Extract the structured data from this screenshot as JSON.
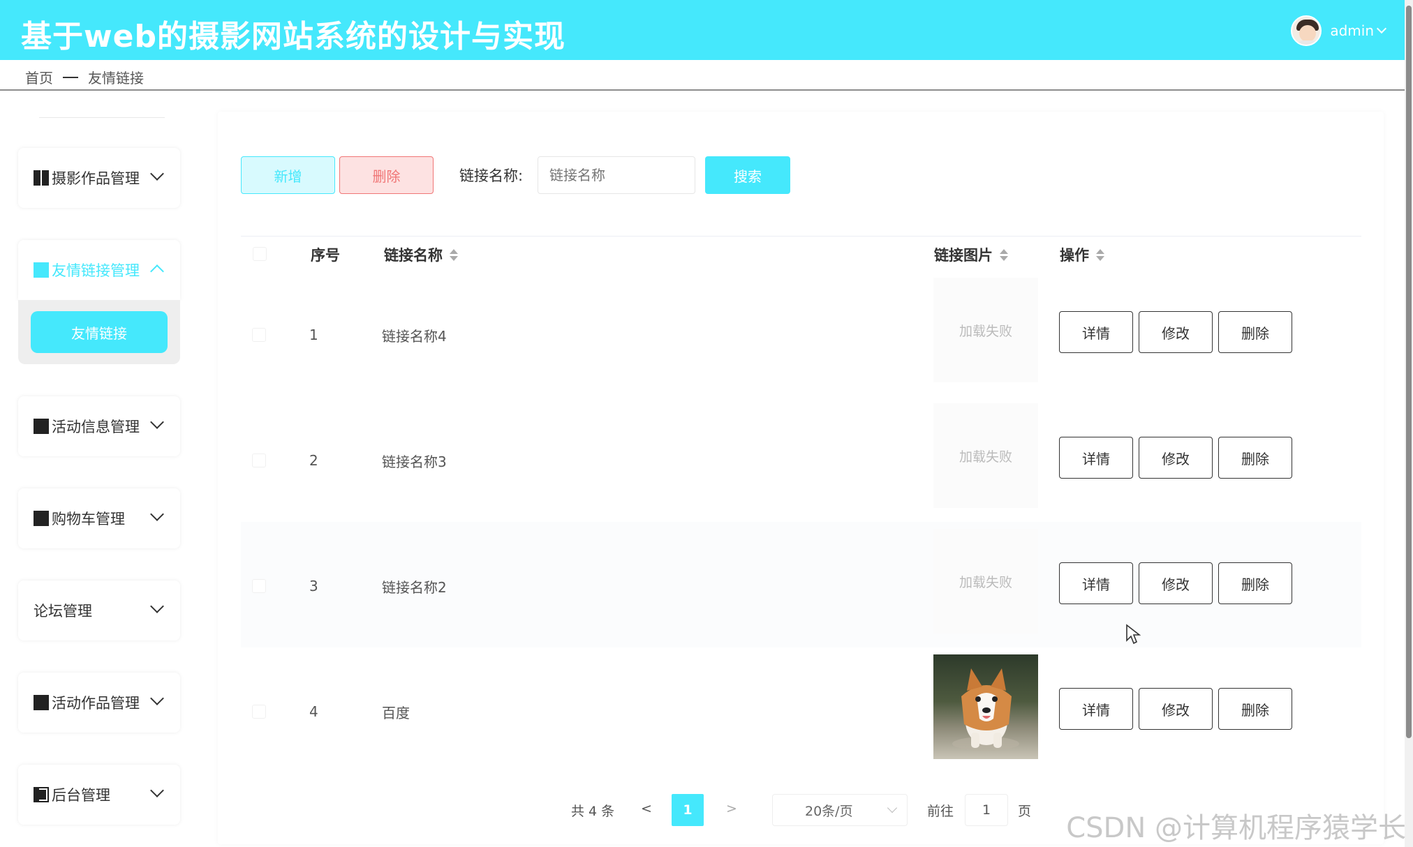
{
  "header": {
    "title": "基于web的摄影网站系统的设计与实现",
    "username": "admin"
  },
  "breadcrumb": {
    "home": "首页",
    "current": "友情链接"
  },
  "sidebar": {
    "items": [
      {
        "label": "摄影作品管理",
        "icon": "grid-icon"
      },
      {
        "label": "友情链接管理",
        "icon": "contact-card-icon",
        "open": true,
        "sub": "友情链接"
      },
      {
        "label": "活动信息管理",
        "icon": "copy-icon"
      },
      {
        "label": "购物车管理",
        "icon": "crop-icon"
      },
      {
        "label": "论坛管理",
        "icon": ""
      },
      {
        "label": "活动作品管理",
        "icon": "gift-icon"
      },
      {
        "label": "后台管理",
        "icon": "panel-icon"
      }
    ]
  },
  "toolbar": {
    "add": "新增",
    "delete": "删除",
    "search_label": "链接名称:",
    "search_placeholder": "链接名称",
    "search": "搜索"
  },
  "table": {
    "headers": {
      "index": "序号",
      "name": "链接名称",
      "image": "链接图片",
      "actions": "操作"
    },
    "rows": [
      {
        "index": "1",
        "name": "链接名称4",
        "image": "加载失败"
      },
      {
        "index": "2",
        "name": "链接名称3",
        "image": "加载失败"
      },
      {
        "index": "3",
        "name": "链接名称2",
        "image": "加载失败"
      },
      {
        "index": "4",
        "name": "百度",
        "image": ""
      }
    ],
    "actions": {
      "detail": "详情",
      "edit": "修改",
      "delete": "删除"
    }
  },
  "pagination": {
    "total": "共 4 条",
    "prev": "<",
    "page": "1",
    "next": ">",
    "size": "20条/页",
    "goto": "前往",
    "goto_value": "1",
    "page_unit": "页"
  },
  "colors": {
    "accent": "#45e8fc",
    "danger": "#f07676"
  },
  "watermark": "CSDN @计算机程序猿学长"
}
